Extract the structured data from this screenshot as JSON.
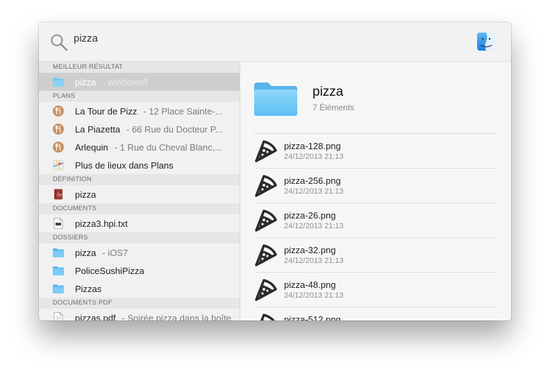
{
  "search": {
    "query": "pizza"
  },
  "sections": [
    {
      "header": "MEILLEUR RÉSULTAT",
      "items": [
        {
          "title": "pizza",
          "subtitle": "- windows8",
          "icon": "folder-icon"
        }
      ]
    },
    {
      "header": "PLANS",
      "items": [
        {
          "title": "La Tour  de Pizz",
          "subtitle": "- 12 Place Sainte-...",
          "icon": "restaurant-pin-icon"
        },
        {
          "title": "La Piazetta",
          "subtitle": "- 66 Rue du Docteur P...",
          "icon": "restaurant-pin-icon"
        },
        {
          "title": "Arlequin",
          "subtitle": "- 1 Rue du Cheval Blanc,...",
          "icon": "restaurant-pin-icon"
        },
        {
          "title": "Plus de lieux dans Plans",
          "subtitle": "",
          "icon": "maps-app-icon"
        }
      ]
    },
    {
      "header": "DÉFINITION",
      "items": [
        {
          "title": "pizza",
          "subtitle": "",
          "icon": "dictionary-icon"
        }
      ]
    },
    {
      "header": "DOCUMENTS",
      "items": [
        {
          "title": "pizza3.hpi.txt",
          "subtitle": "",
          "icon": "text-document-icon"
        }
      ]
    },
    {
      "header": "DOSSIERS",
      "items": [
        {
          "title": "pizza",
          "subtitle": "- iOS7",
          "icon": "folder-icon"
        },
        {
          "title": "PoliceSushiPizza",
          "subtitle": "",
          "icon": "folder-icon"
        },
        {
          "title": "Pizzas",
          "subtitle": "",
          "icon": "folder-icon"
        }
      ]
    },
    {
      "header": "DOCUMENTS PDF",
      "items": [
        {
          "title": "pizzas.pdf",
          "subtitle": "- Soirée pizza dans la boîte",
          "icon": "pdf-document-icon"
        }
      ]
    }
  ],
  "preview": {
    "title": "pizza",
    "count": "7 Éléments",
    "files": [
      {
        "name": "pizza-128.png",
        "date": "24/12/2013 21:13"
      },
      {
        "name": "pizza-256.png",
        "date": "24/12/2013 21:13"
      },
      {
        "name": "pizza-26.png",
        "date": "24/12/2013 21:13"
      },
      {
        "name": "pizza-32.png",
        "date": "24/12/2013 21:13"
      },
      {
        "name": "pizza-48.png",
        "date": "24/12/2013 21:13"
      },
      {
        "name": "pizza-512.png",
        "date": ""
      }
    ]
  },
  "colors": {
    "folder": "#6cc6f5",
    "selection": "#cfcfcf",
    "restaurant_pin": "#c8946a"
  }
}
